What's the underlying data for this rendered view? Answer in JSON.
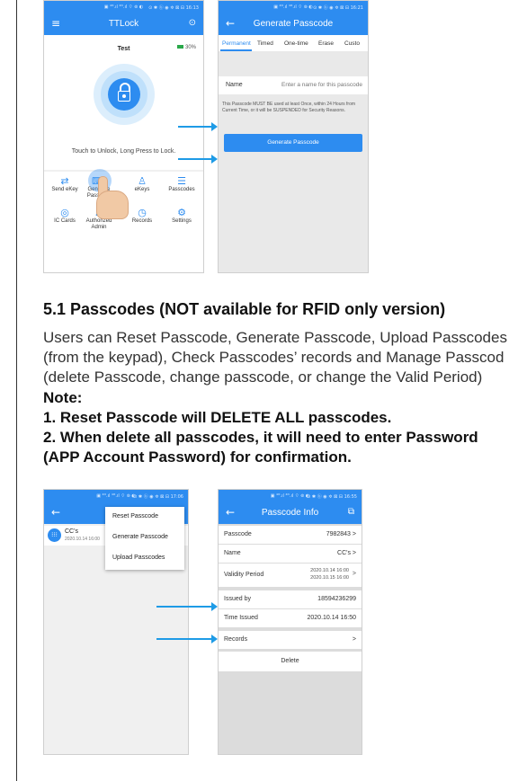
{
  "screen1": {
    "status_text": "▣ ⁴ᴳ.ıl ⁴ᴳ.ıl ⌔ ⊚ ◐",
    "status_right": "⊙ ✱ ⓑ ◉ ✲ ⊠ ⊟ 16:13",
    "title": "TTLock",
    "lock_name": "Test",
    "battery": "30%",
    "hint": "Touch to Unlock, Long Press to Lock.",
    "grid": [
      {
        "label": "Send eKey",
        "icon": "⇄"
      },
      {
        "label": "Generate Passcode",
        "icon": "⌨"
      },
      {
        "label": "eKeys",
        "icon": "♙"
      },
      {
        "label": "Passcodes",
        "icon": "☰"
      },
      {
        "label": "IC Cards",
        "icon": "◎"
      },
      {
        "label": "Authorized Admin",
        "icon": "♟"
      },
      {
        "label": "Records",
        "icon": "◷"
      },
      {
        "label": "Settings",
        "icon": "⚙"
      }
    ]
  },
  "screen2": {
    "status_text": "▣ ⁴ᴳ.ıl ⁴ᴳ.ıl ⌔ ⊚ ◐",
    "status_right": "⊙ ✱ ⓑ ◉ ✲ ⊠ ⊟ 16:21",
    "title": "Generate Passcode",
    "tabs": [
      "Permanent",
      "Timed",
      "One-time",
      "Erase",
      "Custo"
    ],
    "name_label": "Name",
    "name_placeholder": "Enter a name for this passcode",
    "notice": "This Passcode MUST BE used at least Once, within 24 Hours from Current Time, or it will be SUSPENDED for Security Reasons.",
    "button": "Generate Passcode"
  },
  "section": {
    "heading": "5.1 Passcodes (NOT available for RFID only version)",
    "para": [
      "Users can Reset Passcode, Generate Passcode, Upload Passcodes",
      "(from the keypad), Check Passcodes’ records and Manage Passcod",
      "(delete Passcode, change passcode, or change the Valid Period)"
    ],
    "note_title": "Note:",
    "note_lines": [
      "1. Reset Passcode will DELETE ALL passcodes.",
      "2. When delete all passcodes, it will need to enter Password",
      "(APP Account Password) for confirmation."
    ]
  },
  "screen3": {
    "status_text": "▣ ⁴ᴳ.ıl ⁴ᴳ.ıl ⌔ ⊚ ◐",
    "status_right": "⊙ ✱ ⓑ ◉ ✲ ⊠ ⊟ 17:06",
    "title": "Pas",
    "menu": [
      "Reset Passcode",
      "Generate Passcode",
      "Upload Passcodes"
    ],
    "item_name": "CC's",
    "item_date": "2020.10.14 16:00"
  },
  "screen4": {
    "status_text": "▣ ⁴ᴳ.ıl ⁴ᴳ.ıl ⌔ ⊚ ◐",
    "status_right": "⊙ ✱ ⓑ ◉ ✲ ⊠ ⊟ 16:55",
    "title": "Passcode Info",
    "rows": [
      {
        "k": "Passcode",
        "v": "7982843 >"
      },
      {
        "k": "Name",
        "v": "CC's >"
      },
      {
        "k": "Validity Period",
        "v1": "2020.10.14 16:00",
        "v2": "2020.10.15 16:00",
        "chev": ">"
      },
      {
        "k": "Issued by",
        "v": "18594236299"
      },
      {
        "k": "Time Issued",
        "v": "2020.10.14 16:50"
      },
      {
        "k": "Records",
        "v": ">"
      }
    ],
    "delete": "Delete"
  },
  "colors": {
    "accent": "#2d8cf0",
    "arrow": "#1e9be6"
  }
}
